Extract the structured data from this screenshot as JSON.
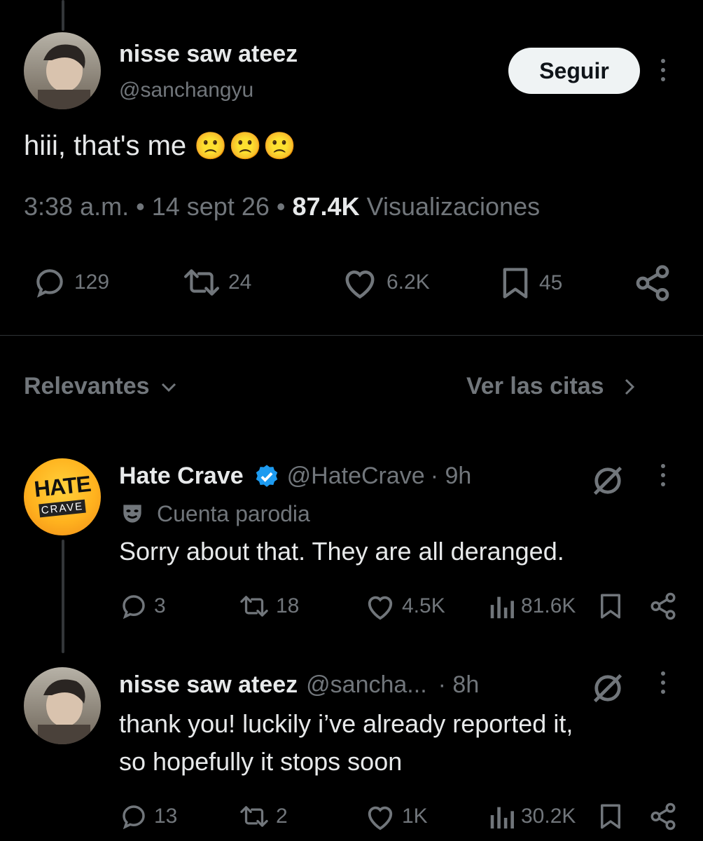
{
  "main_post": {
    "display_name": "nisse saw ateez",
    "handle": "@sanchangyu",
    "follow_label": "Seguir",
    "text": "hiii, that's me",
    "emoji": "🙁🙁🙁",
    "time": "3:38 a.m.",
    "sep1": "•",
    "date": "14 sept 26",
    "sep2": "•",
    "views_count": "87.4K",
    "views_label": "Visualizaciones",
    "replies": "129",
    "reposts": "24",
    "likes": "6.2K",
    "bookmarks": "45"
  },
  "sort_bar": {
    "sort_label": "Relevantes",
    "quotes_label": "Ver las citas"
  },
  "reply1": {
    "avatar_text_top": "HATE",
    "avatar_text_bottom": "CRAVE",
    "display_name": "Hate Crave",
    "handle": "@HateCrave",
    "time": "· 9h",
    "parody_label": "Cuenta parodia",
    "text": "Sorry about that. They are all deranged.",
    "replies": "3",
    "reposts": "18",
    "likes": "4.5K",
    "views": "81.6K"
  },
  "reply2": {
    "display_name": "nisse saw ateez",
    "handle": "@sancha...",
    "time": "· 8h",
    "text_line1": "thank you! luckily i’ve already reported it,",
    "text_line2": "so hopefully it stops soon",
    "replies": "13",
    "reposts": "2",
    "likes": "1K",
    "views": "30.2K"
  },
  "colors": {
    "background": "#000000",
    "text": "#e7e9ea",
    "secondary": "#71767b",
    "verified": "#1d9bf0",
    "divider": "#2f3336"
  }
}
